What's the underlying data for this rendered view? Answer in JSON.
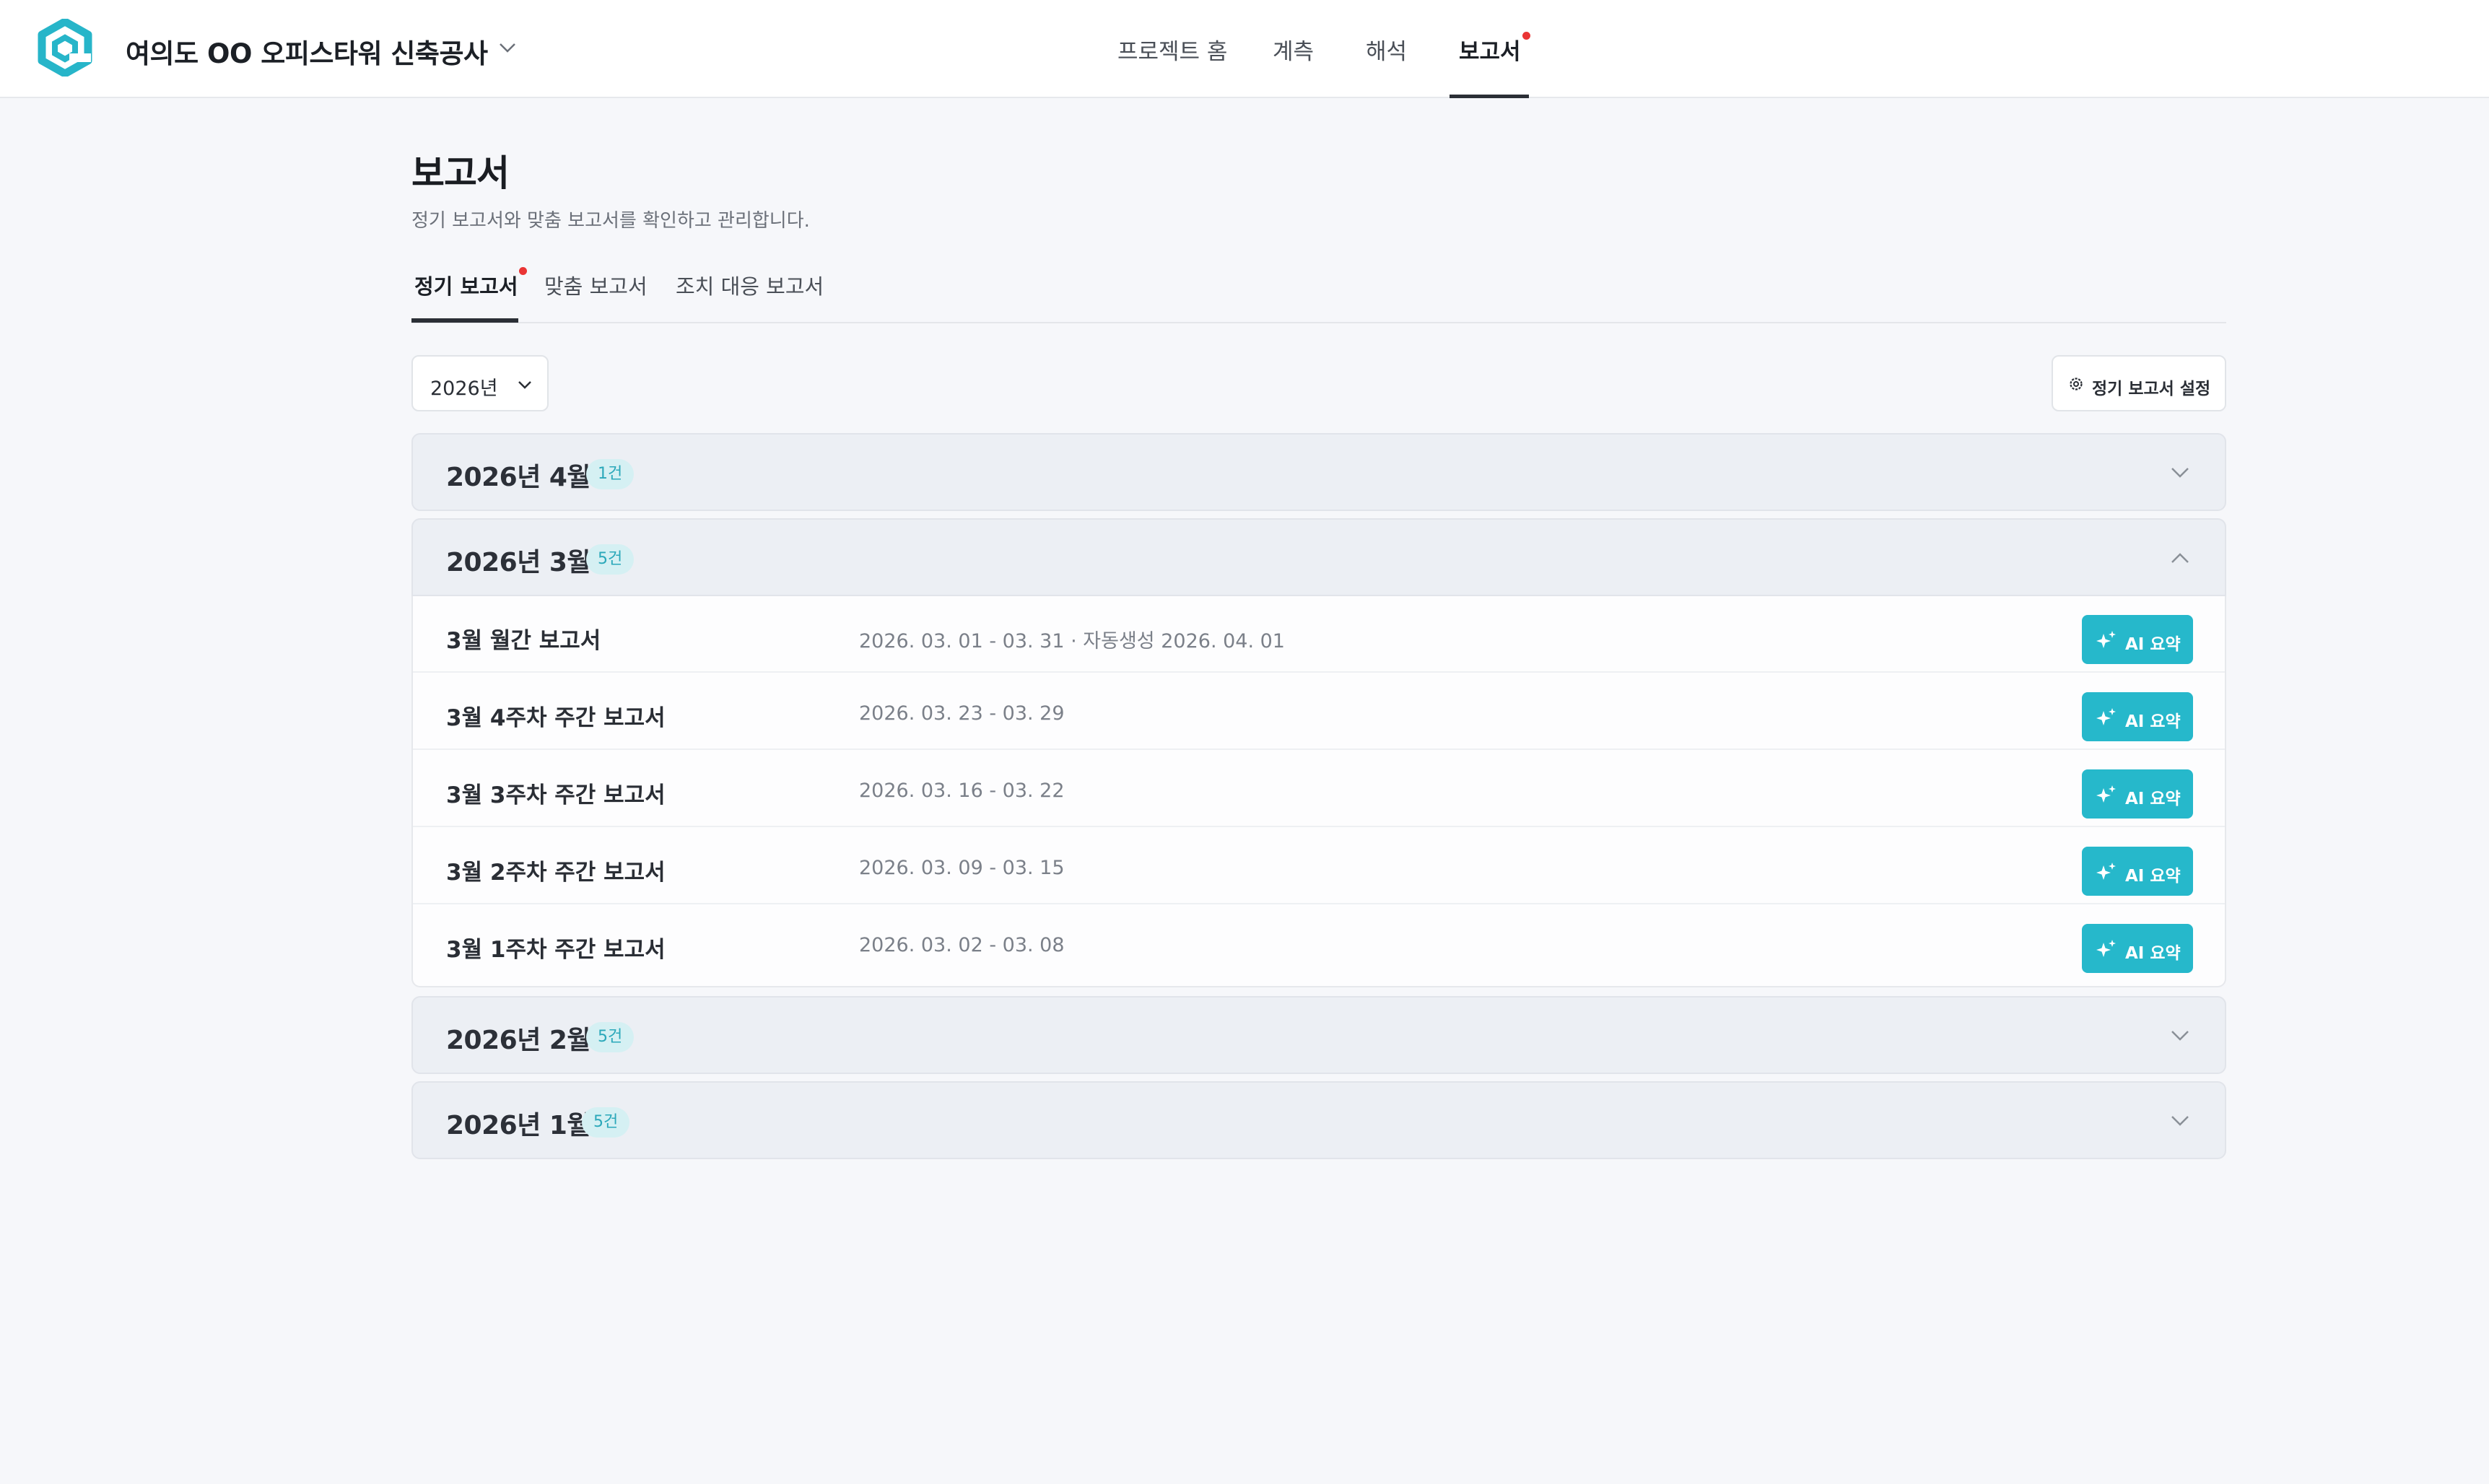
{
  "header": {
    "project_title": "여의도 OO 오피스타워 신축공사",
    "nav": [
      {
        "label": "프로젝트 홈"
      },
      {
        "label": "계측"
      },
      {
        "label": "해석"
      },
      {
        "label": "보고서",
        "active": true,
        "has_notification": true
      }
    ]
  },
  "page": {
    "title": "보고서",
    "subtitle": "정기 보고서와 맞춤 보고서를 확인하고 관리합니다."
  },
  "tabs": [
    {
      "label": "정기 보고서",
      "active": true,
      "has_notification": true
    },
    {
      "label": "맞춤 보고서"
    },
    {
      "label": "조치 대응 보고서"
    }
  ],
  "controls": {
    "year_select": "2026년",
    "settings_label": "정기 보고서 설정"
  },
  "months": [
    {
      "label": "2026년 4월",
      "count": "1건",
      "expanded": false
    },
    {
      "label": "2026년 3월",
      "count": "5건",
      "expanded": true
    },
    {
      "label": "2026년 2월",
      "count": "5건",
      "expanded": false
    },
    {
      "label": "2026년 1월",
      "count": "5건",
      "expanded": false
    }
  ],
  "reports": [
    {
      "name": "3월 월간 보고서",
      "date": "2026. 03. 01 - 03. 31 · 자동생성 2026. 04. 01",
      "action": "AI 요약"
    },
    {
      "name": "3월 4주차 주간 보고서",
      "date": "2026. 03. 23 - 03. 29",
      "action": "AI 요약"
    },
    {
      "name": "3월 3주차 주간 보고서",
      "date": "2026. 03. 16 - 03. 22",
      "action": "AI 요약"
    },
    {
      "name": "3월 2주차 주간 보고서",
      "date": "2026. 03. 09 - 03. 15",
      "action": "AI 요약"
    },
    {
      "name": "3월 1주차 주간 보고서",
      "date": "2026. 03. 02 - 03. 08",
      "action": "AI 요약"
    }
  ],
  "colors": {
    "accent": "#26b8cb",
    "notification": "#ea3434",
    "badge_bg": "#d5f0f3",
    "badge_text": "#2ba8ba"
  }
}
